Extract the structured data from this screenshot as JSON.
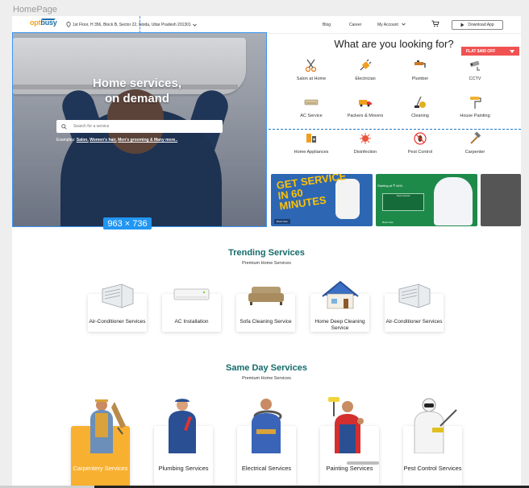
{
  "canvas_label": "HomePage",
  "size_badge": "963 × 736",
  "header": {
    "logo_part1": "opt",
    "logo_part2": "busy",
    "address": "1st Floor, H 356, Block B, Sector 22, Noida, Uttar Pradesh 201301",
    "nav": [
      "Blog",
      "Career",
      "My Account"
    ],
    "download_label": "Download App"
  },
  "hero": {
    "title_line1": "Home services,",
    "title_line2": "on demand",
    "search_placeholder": "Search for a service",
    "examples_prefix": "Examples:",
    "examples_links": [
      "Salon,",
      "Women's hair,",
      "Men's grooming & Many more.."
    ]
  },
  "categories": {
    "title": "What are you looking for?",
    "promo": "FLAT $400 OFF",
    "items": [
      {
        "label": "Salon at Home",
        "icon": "scissors-icon"
      },
      {
        "label": "Electrician",
        "icon": "plug-icon"
      },
      {
        "label": "Plumber",
        "icon": "faucet-icon"
      },
      {
        "label": "CCTV",
        "icon": "cctv-icon"
      },
      {
        "label": "AC Service",
        "icon": "ac-icon"
      },
      {
        "label": "Packers & Movers",
        "icon": "truck-icon"
      },
      {
        "label": "Cleaning",
        "icon": "vacuum-icon"
      },
      {
        "label": "House Painting",
        "icon": "paint-roller-icon"
      },
      {
        "label": "Home Appliances",
        "icon": "appliance-icon"
      },
      {
        "label": "Disinfection",
        "icon": "virus-icon"
      },
      {
        "label": "Pest Control",
        "icon": "bug-icon"
      },
      {
        "label": "Carpenter",
        "icon": "hammer-icon"
      }
    ]
  },
  "banners": {
    "b1_line1": "GET SERVICE",
    "b1_line2": "IN 60",
    "b1_line3": "MINUTES",
    "b1_caption": "Book Now",
    "b2_text": "Starting at ₹ 449/-",
    "b2_card": "Pest Control",
    "b2_caption": "Book Now"
  },
  "trending": {
    "title": "Trending Services",
    "subtitle": "Premium Home Services",
    "items": [
      "Air-Conditioner Services",
      "AC Installation",
      "Sofa Cleaning Service",
      "Home Deep Cleaning Service",
      "Air-Conditioner Services"
    ]
  },
  "sameday": {
    "title": "Same Day Services",
    "subtitle": "Premium Home Services",
    "items": [
      "Carpentery Services",
      "Plumbing Services",
      "Electrical Services",
      "Painting Services",
      "Pest Control Services"
    ]
  },
  "colors": {
    "accent_teal": "#136b6a",
    "promo_red": "#f05252",
    "active_card": "#f8b030",
    "selection_blue": "#2196f3"
  }
}
